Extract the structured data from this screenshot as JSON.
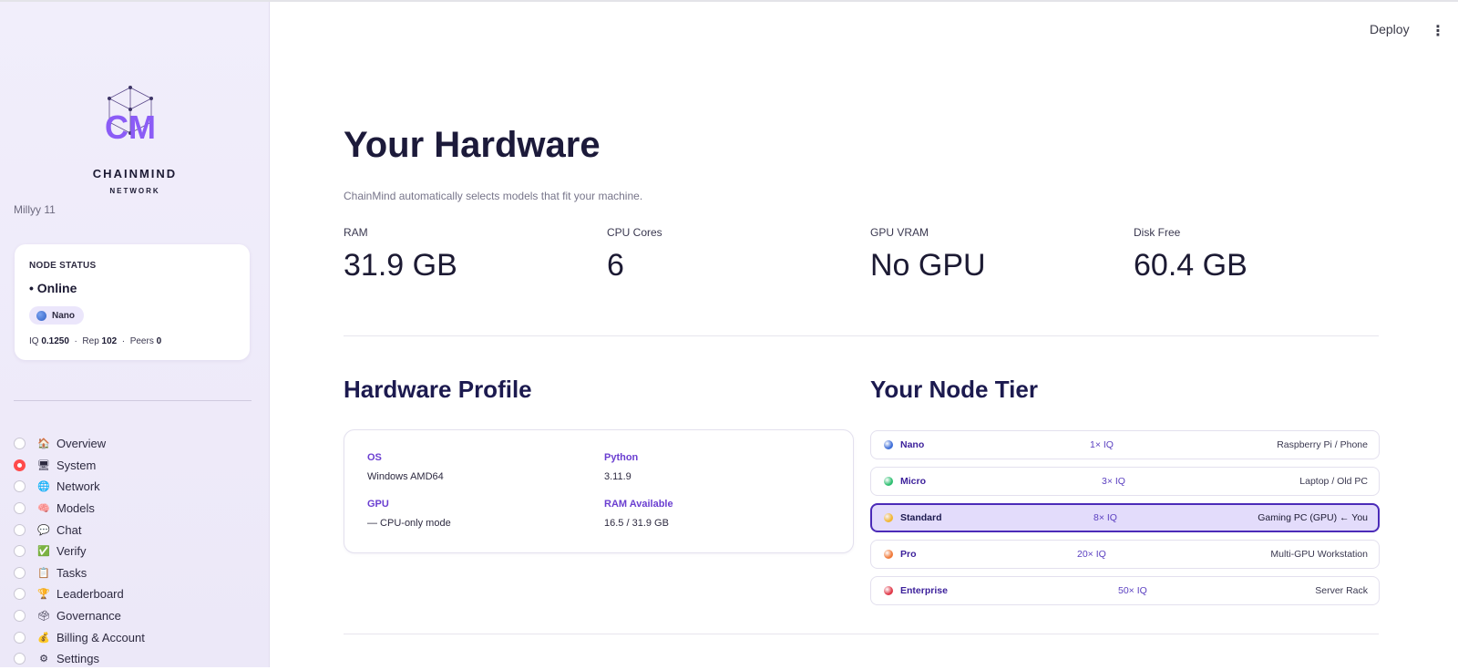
{
  "sidebar": {
    "brand_name": "CHAINMIND",
    "brand_sub": "NETWORK",
    "username": "Millyy 11",
    "node_status": {
      "title": "NODE STATUS",
      "online": "• Online",
      "badge": "Nano",
      "iq_label": "IQ",
      "iq_value": "0.1250",
      "rep_label": "Rep",
      "rep_value": "102",
      "peers_label": "Peers",
      "peers_value": "0",
      "separator": "·"
    },
    "nav": [
      {
        "icon": "🏠",
        "label": "Overview",
        "selected": false
      },
      {
        "icon": "🖥",
        "label": "System",
        "selected": true
      },
      {
        "icon": "🌐",
        "label": "Network",
        "selected": false
      },
      {
        "icon": "🧠",
        "label": "Models",
        "selected": false
      },
      {
        "icon": "💬",
        "label": "Chat",
        "selected": false
      },
      {
        "icon": "✅",
        "label": "Verify",
        "selected": false
      },
      {
        "icon": "📋",
        "label": "Tasks",
        "selected": false
      },
      {
        "icon": "🏆",
        "label": "Leaderboard",
        "selected": false
      },
      {
        "icon": "🗳",
        "label": "Governance",
        "selected": false
      },
      {
        "icon": "💰",
        "label": "Billing & Account",
        "selected": false
      },
      {
        "icon": "⚙",
        "label": "Settings",
        "selected": false
      }
    ]
  },
  "header": {
    "deploy_label": "Deploy",
    "menu_glyph": "⋮"
  },
  "main": {
    "title": "Your Hardware",
    "subtitle": "ChainMind automatically selects models that fit your machine.",
    "metrics": [
      {
        "label": "RAM",
        "value": "31.9 GB"
      },
      {
        "label": "CPU Cores",
        "value": "6"
      },
      {
        "label": "GPU VRAM",
        "value": "No GPU"
      },
      {
        "label": "Disk Free",
        "value": "60.4 GB"
      }
    ],
    "profile": {
      "heading": "Hardware Profile",
      "os_label": "OS",
      "os_value": "Windows AMD64",
      "python_label": "Python",
      "python_value": "3.11.9",
      "gpu_label": "GPU",
      "gpu_value": "— CPU-only mode",
      "ram_label": "RAM Available",
      "ram_value": "16.5 / 31.9 GB"
    },
    "tiers": {
      "heading": "Your Node Tier",
      "items": [
        {
          "name": "Nano",
          "iq": "1× IQ",
          "desc": "Raspberry Pi / Phone",
          "color": "#3f6fd8",
          "selected": false
        },
        {
          "name": "Micro",
          "iq": "3× IQ",
          "desc": "Laptop / Old PC",
          "color": "#2fbf71",
          "selected": false
        },
        {
          "name": "Standard",
          "iq": "8× IQ",
          "desc": "Gaming PC (GPU) ← You",
          "color": "#f2b632",
          "selected": true
        },
        {
          "name": "Pro",
          "iq": "20× IQ",
          "desc": "Multi-GPU Workstation",
          "color": "#f07a3a",
          "selected": false
        },
        {
          "name": "Enterprise",
          "iq": "50× IQ",
          "desc": "Server Rack",
          "color": "#e03a4a",
          "selected": false
        }
      ]
    }
  },
  "colors": {
    "accent": "#6b3fd1",
    "heading": "#1c1a4f",
    "selected_radio": "#ff4b4b"
  }
}
